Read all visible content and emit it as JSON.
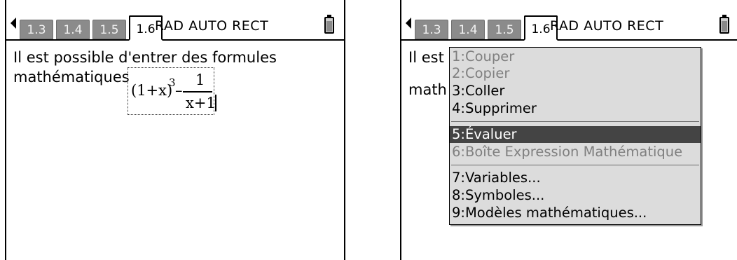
{
  "tabs": [
    "1.3",
    "1.4",
    "1.5",
    "1.6"
  ],
  "status": "RAD AUTO RECT",
  "left": {
    "line1": "Il est possible d'entrer des formules",
    "line2": "mathématiques",
    "math": {
      "base": "(1+x)",
      "exponent": "3",
      "minus": "–",
      "numerator": "1",
      "denominator": "x+1"
    }
  },
  "right": {
    "line1_visible": "Il est",
    "line2_visible": "math",
    "menu": [
      {
        "label": "1:Couper",
        "state": "disabled"
      },
      {
        "label": "2:Copier",
        "state": "disabled"
      },
      {
        "label": "3:Coller",
        "state": "enabled"
      },
      {
        "label": "4:Supprimer",
        "state": "enabled"
      },
      {
        "label": "5:Évaluer",
        "state": "selected"
      },
      {
        "label": "6:Boîte Expression Mathématique",
        "state": "disabled"
      },
      {
        "label": "7:Variables...",
        "state": "enabled"
      },
      {
        "label": "8:Symboles...",
        "state": "enabled"
      },
      {
        "label": "9:Modèles mathématiques...",
        "state": "enabled"
      }
    ]
  },
  "colors": {
    "tab_inactive": "#8b8b8b",
    "menu_bg": "#dcdcdc",
    "menu_selected": "#444444",
    "disabled_text": "#7f7f7f"
  }
}
